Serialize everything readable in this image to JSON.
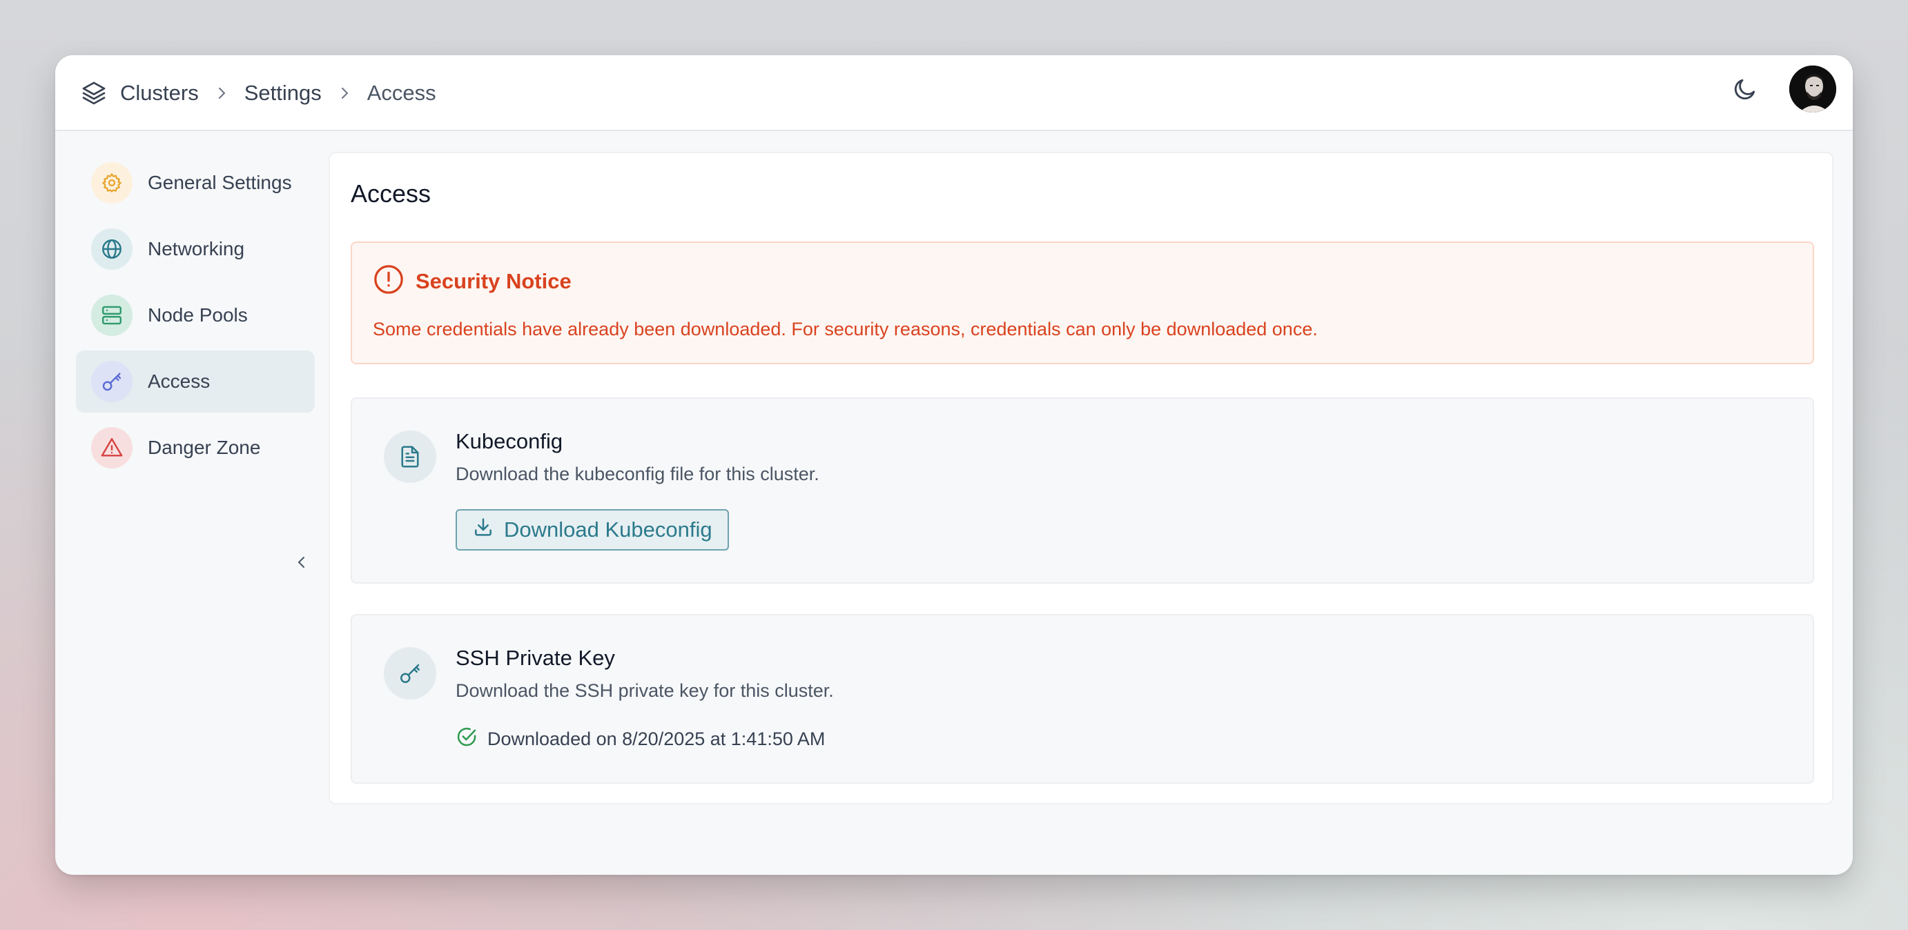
{
  "header": {
    "breadcrumb": [
      "Clusters",
      "Settings",
      "Access"
    ]
  },
  "sidebar": {
    "items": [
      {
        "label": "General Settings",
        "icon": "gear-icon",
        "color": "#e8a52c",
        "bg": "#fdf1de"
      },
      {
        "label": "Networking",
        "icon": "globe-icon",
        "color": "#2b7a8c",
        "bg": "#dfecef"
      },
      {
        "label": "Node Pools",
        "icon": "server-icon",
        "color": "#2f9a6e",
        "bg": "#d4ece1"
      },
      {
        "label": "Access",
        "icon": "key-icon",
        "color": "#5b6bd6",
        "bg": "#dde2f6"
      },
      {
        "label": "Danger Zone",
        "icon": "warning-icon",
        "color": "#d64040",
        "bg": "#f8dfdf"
      }
    ],
    "active_index": 3
  },
  "main": {
    "title": "Access",
    "notice": {
      "title": "Security Notice",
      "text": "Some credentials have already been downloaded. For security reasons, credentials can only be downloaded once.",
      "color": "#d9421f"
    },
    "kubeconfig": {
      "title": "Kubeconfig",
      "description": "Download the kubeconfig file for this cluster.",
      "button_label": "Download Kubeconfig",
      "icon": "file-icon"
    },
    "ssh": {
      "title": "SSH Private Key",
      "description": "Download the SSH private key for this cluster.",
      "status": "Downloaded on 8/20/2025 at 1:41:50 AM",
      "icon": "key-icon",
      "status_icon": "check-circle-icon",
      "status_color": "#2f9a4e"
    }
  }
}
